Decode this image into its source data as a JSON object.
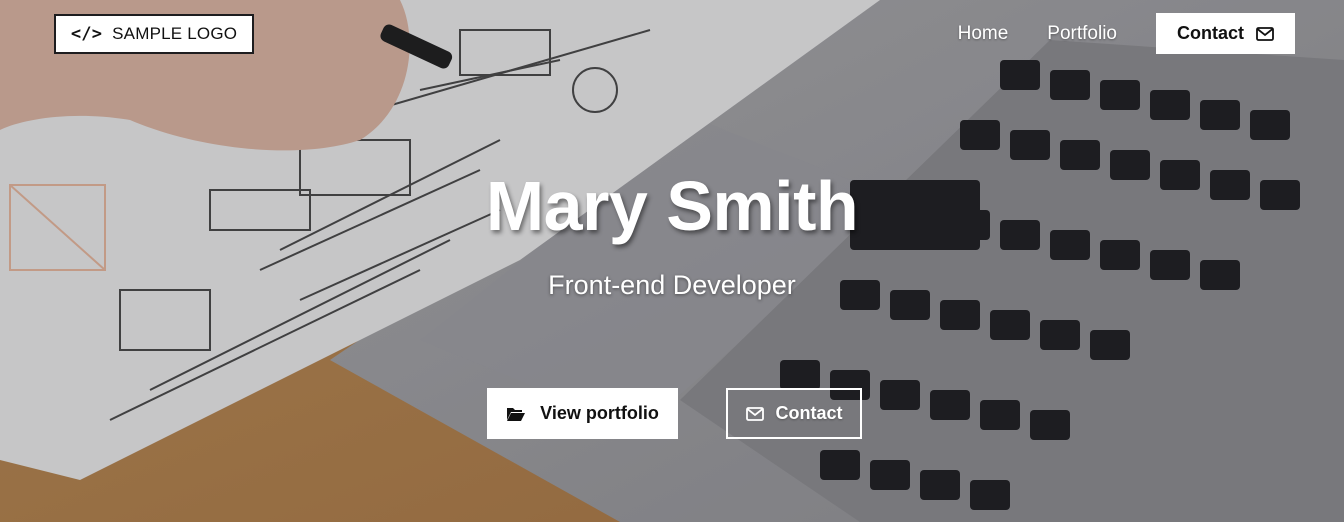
{
  "logo": {
    "icon": "code-icon",
    "text": "SAMPLE LOGO"
  },
  "nav": {
    "items": [
      {
        "label": "Home"
      },
      {
        "label": "Portfolio"
      }
    ],
    "contact_label": "Contact",
    "contact_icon": "envelope-icon"
  },
  "hero": {
    "name": "Mary Smith",
    "role": "Front-end Developer",
    "portfolio_button": {
      "label": "View portfolio",
      "icon": "folder-open-icon"
    },
    "contact_button": {
      "label": "Contact",
      "icon": "envelope-icon"
    }
  },
  "colors": {
    "text_light": "#ffffff",
    "button_bg": "#ffffff",
    "text_dark": "#111111",
    "desk_wood": "#c9904f",
    "laptop_silver": "#b8b8bb",
    "keyboard_keys": "#1b1b1d"
  }
}
